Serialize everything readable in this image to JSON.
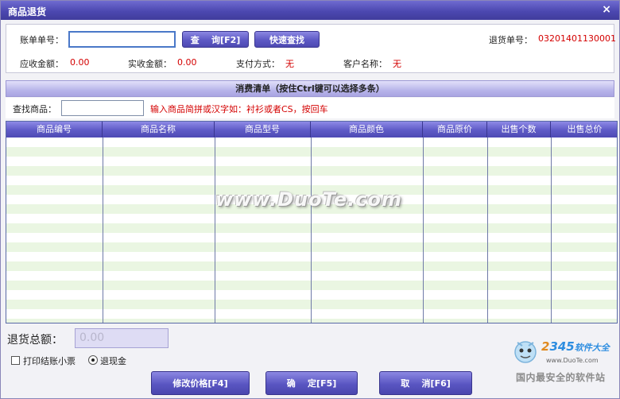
{
  "window": {
    "title": "商品退货",
    "close_glyph": "×"
  },
  "header": {
    "bill_no_label": "账单单号：",
    "bill_no_value": "",
    "query_button": "查    询[F2]",
    "quick_search_button": "快速查找",
    "return_no_label": "退货单号：",
    "return_no_value": "03201401130001",
    "receivable_label": "应收金额：",
    "receivable_value": "0.00",
    "received_label": "实收金额：",
    "received_value": "0.00",
    "payment_label": "支付方式：",
    "payment_value": "无",
    "customer_label": "客户名称：",
    "customer_value": "无"
  },
  "list": {
    "section_title": "消费清单（按住Ctrl键可以选择多条）",
    "search_label": "查找商品：",
    "search_value": "",
    "search_hint": "输入商品简拼或汉字如：衬衫或者CS，按回车",
    "columns": [
      "商品编号",
      "商品名称",
      "商品型号",
      "商品颜色",
      "商品原价",
      "出售个数",
      "出售总价"
    ],
    "rows": []
  },
  "bottom": {
    "total_label": "退货总额：",
    "total_value": "0.00",
    "print_receipt_label": "打印结账小票",
    "print_receipt_checked": false,
    "refund_cash_label": "退现金",
    "refund_cash_selected": true,
    "modify_price_button": "修改价格[F4]",
    "confirm_button": "确    定[F5]",
    "cancel_button": "取    消[F6]"
  },
  "watermark": {
    "text": "www.DuoTe.com",
    "brand_prefix": "2",
    "brand_number": "345",
    "brand_suffix": "软件大全",
    "brand_url": "www.DuoTe.com",
    "brand_slogan": "国内最安全的软件站"
  },
  "colors": {
    "accent": "#5a56c2",
    "value_red": "#d40000",
    "row_stripe": "#eaf6e2"
  }
}
